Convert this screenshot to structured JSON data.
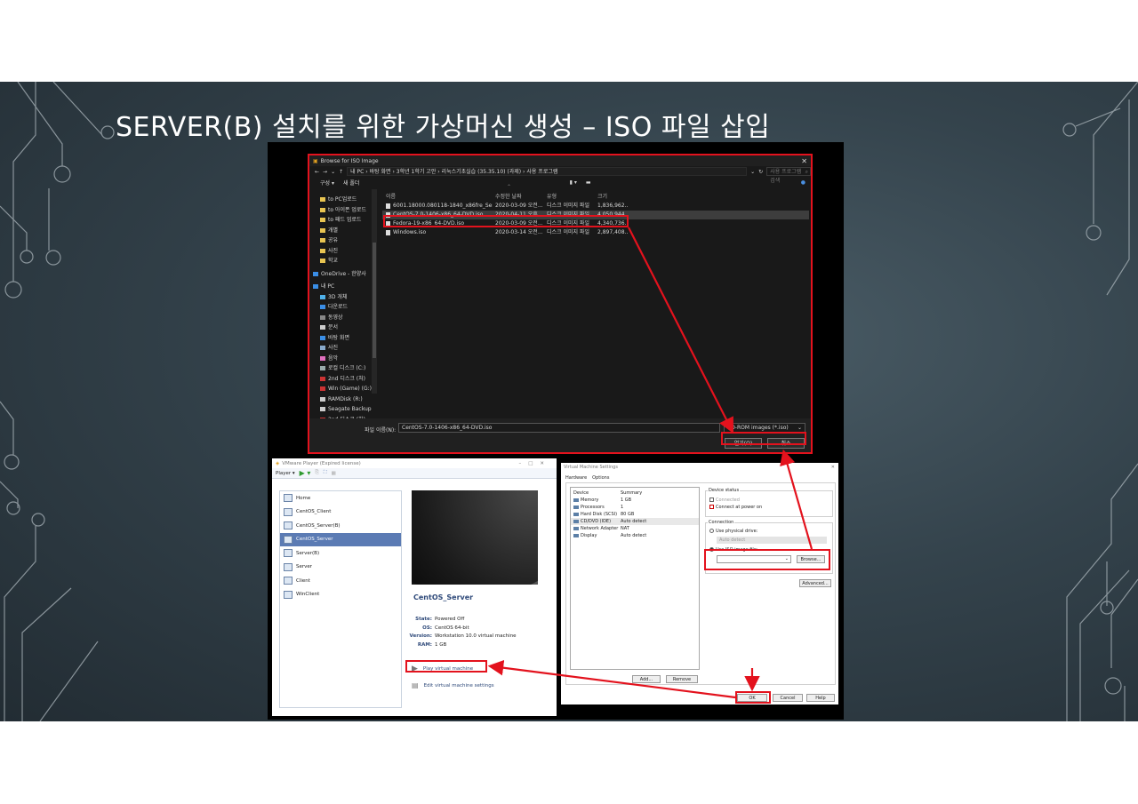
{
  "slide": {
    "title": "SERVER(B) 설치를 위한 가상머신 생성 – ISO 파일 삽입"
  },
  "browse_dialog": {
    "title": "Browse for ISO Image",
    "address_path": "내 PC  ›  바탕 화면  ›  3학년 1학기 고안  ›  리눅스기초실습 (35.35.10) (과제)  ›  사용 프로그램",
    "search_placeholder": "사용 프로그램 검색",
    "toolbar": {
      "organize": "구성 ▾",
      "new_folder": "새 폴더"
    },
    "nav_items": [
      "to PC업로드",
      "to 아이폰 업로드",
      "to 패드 업로드",
      "개별",
      "공유",
      "사진",
      "학교",
      "OneDrive - 한양사",
      "내 PC",
      "3D 개체",
      "다운로드",
      "동영상",
      "문서",
      "바탕 화면",
      "사진",
      "음악",
      "로컬 디스크 (C:)",
      "2nd 디스크 (처)",
      "Win (Game) (G:)",
      "RAMDisk (R:)",
      "Seagate Backup",
      "2nd 디스크 (처)"
    ],
    "columns": [
      "이름",
      "수정한 날짜",
      "유형",
      "크기"
    ],
    "files": [
      {
        "name": "6001.18000.080118-1840_x86fre_Serve",
        "date": "2020-03-09 오전...",
        "type": "디스크 이미지 파일",
        "size": "1,836,962..."
      },
      {
        "name": "CentOS-7.0-1406-x86_64-DVD.iso",
        "date": "2020-04-11 오후...",
        "type": "디스크 이미지 파일",
        "size": "4,050,944..."
      },
      {
        "name": "Fedora-19-x86_64-DVD.iso",
        "date": "2020-03-09 오전...",
        "type": "디스크 이미지 파일",
        "size": "4,340,736..."
      },
      {
        "name": "Windows.iso",
        "date": "2020-03-14 오전...",
        "type": "디스크 이미지 파일",
        "size": "2,897,408..."
      }
    ],
    "filename_label": "파일 이름(N):",
    "filename_value": "CentOS-7.0-1406-x86_64-DVD.iso",
    "filetype_value": "CD-ROM images (*.iso)",
    "open_button": "열기(O)",
    "cancel_button": "취소"
  },
  "vmware_player": {
    "title": "VMware Player (Expired license)",
    "menu_player": "Player ▾",
    "library": [
      "Home",
      "CentOS_Client",
      "CentOS_Server(B)",
      "CentOS_Server",
      "Server(B)",
      "Server",
      "Client",
      "WinClient"
    ],
    "selected_vm": "CentOS_Server",
    "details": [
      {
        "key": "State:",
        "value": "Powered Off"
      },
      {
        "key": "OS:",
        "value": "CentOS 64-bit"
      },
      {
        "key": "Version:",
        "value": "Workstation 10.0 virtual machine"
      },
      {
        "key": "RAM:",
        "value": "1 GB"
      }
    ],
    "play_action": "Play virtual machine",
    "edit_action": "Edit virtual machine settings"
  },
  "vm_settings": {
    "title": "Virtual Machine Settings",
    "tabs": [
      "Hardware",
      "Options"
    ],
    "list_headers": [
      "Device",
      "Summary"
    ],
    "devices": [
      {
        "device": "Memory",
        "summary": "1 GB"
      },
      {
        "device": "Processors",
        "summary": "1"
      },
      {
        "device": "Hard Disk (SCSI)",
        "summary": "80 GB"
      },
      {
        "device": "CD/DVD (IDE)",
        "summary": "Auto detect"
      },
      {
        "device": "Network Adapter",
        "summary": "NAT"
      },
      {
        "device": "Display",
        "summary": "Auto detect"
      }
    ],
    "device_status_label": "Device status",
    "connected_label": "Connected",
    "connect_power_label": "Connect at power on",
    "connection_label": "Connection",
    "physical_drive_label": "Use physical drive:",
    "physical_drive_value": "Auto detect",
    "iso_label": "Use ISO image file:",
    "browse_button": "Browse...",
    "advanced_button": "Advanced...",
    "add_button": "Add...",
    "remove_button": "Remove",
    "ok_button": "OK",
    "cancel_button": "Cancel",
    "help_button": "Help"
  },
  "colors": {
    "highlight": "#e3121d",
    "slide_bg": "#34434c"
  }
}
